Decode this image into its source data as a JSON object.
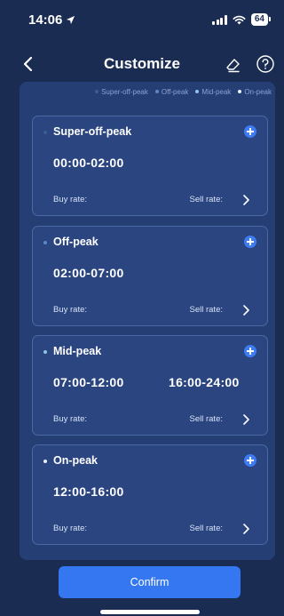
{
  "status_bar": {
    "time": "14:06",
    "battery": "64"
  },
  "nav": {
    "title": "Customize",
    "back_icon": "chevron-left-icon",
    "edit_icon": "eraser-icon",
    "help_icon": "question-circle-icon"
  },
  "legend": [
    {
      "label": "Super-off-peak",
      "color": "#3b5c97"
    },
    {
      "label": "Off-peak",
      "color": "#5f86c7"
    },
    {
      "label": "Mid-peak",
      "color": "#8fc4e8"
    },
    {
      "label": "On-peak",
      "color": "#e8f2fb"
    }
  ],
  "periods": [
    {
      "title": "Super-off-peak",
      "dot_color": "#3b5c97",
      "times": [
        "00:00-02:00"
      ],
      "buy_label": "Buy rate:",
      "sell_label": "Sell rate:"
    },
    {
      "title": "Off-peak",
      "dot_color": "#5f86c7",
      "times": [
        "02:00-07:00"
      ],
      "buy_label": "Buy rate:",
      "sell_label": "Sell rate:"
    },
    {
      "title": "Mid-peak",
      "dot_color": "#8fc4e8",
      "times": [
        "07:00-12:00",
        "16:00-24:00"
      ],
      "buy_label": "Buy rate:",
      "sell_label": "Sell rate:"
    },
    {
      "title": "On-peak",
      "dot_color": "#e8f2fb",
      "times": [
        "12:00-16:00"
      ],
      "buy_label": "Buy rate:",
      "sell_label": "Sell rate:"
    }
  ],
  "confirm_label": "Confirm",
  "colors": {
    "background": "#1a2c52",
    "panel": "#253e74",
    "accent": "#3477f0"
  }
}
